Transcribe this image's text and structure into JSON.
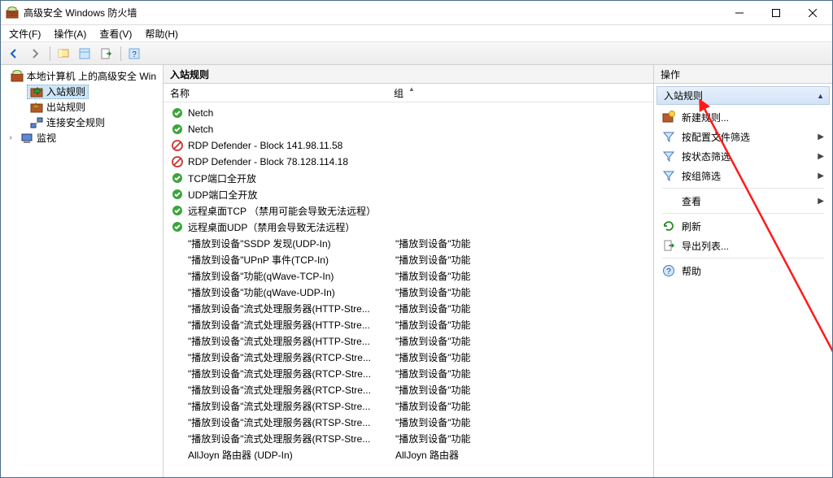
{
  "title": "高级安全 Windows 防火墙",
  "menus": {
    "file": "文件(F)",
    "action": "操作(A)",
    "view": "查看(V)",
    "help": "帮助(H)"
  },
  "tree": {
    "root": "本地计算机 上的高级安全 Win",
    "inbound": "入站规则",
    "outbound": "出站规则",
    "connsec": "连接安全规则",
    "monitor": "监视"
  },
  "columns": {
    "name": "名称",
    "group": "组"
  },
  "right": {
    "header": "操作",
    "section": "入站规则",
    "new_rule": "新建规则...",
    "filter_profile": "按配置文件筛选",
    "filter_state": "按状态筛选",
    "filter_group": "按组筛选",
    "view": "查看",
    "refresh": "刷新",
    "export": "导出列表...",
    "help": "帮助"
  },
  "rules": [
    {
      "icon": "allow",
      "name": "Netch",
      "group": ""
    },
    {
      "icon": "allow",
      "name": "Netch",
      "group": ""
    },
    {
      "icon": "block",
      "name": "RDP Defender - Block 141.98.11.58",
      "group": ""
    },
    {
      "icon": "block",
      "name": "RDP Defender - Block 78.128.114.18",
      "group": ""
    },
    {
      "icon": "allow",
      "name": "TCP端口全开放",
      "group": ""
    },
    {
      "icon": "allow",
      "name": "UDP端口全开放",
      "group": ""
    },
    {
      "icon": "allow",
      "name": "远程桌面TCP （禁用可能会导致无法远程）",
      "group": ""
    },
    {
      "icon": "allow",
      "name": "远程桌面UDP（禁用会导致无法远程）",
      "group": ""
    },
    {
      "icon": "none",
      "name": "\"播放到设备\"SSDP 发现(UDP-In)",
      "group": "\"播放到设备\"功能"
    },
    {
      "icon": "none",
      "name": "\"播放到设备\"UPnP 事件(TCP-In)",
      "group": "\"播放到设备\"功能"
    },
    {
      "icon": "none",
      "name": "\"播放到设备\"功能(qWave-TCP-In)",
      "group": "\"播放到设备\"功能"
    },
    {
      "icon": "none",
      "name": "\"播放到设备\"功能(qWave-UDP-In)",
      "group": "\"播放到设备\"功能"
    },
    {
      "icon": "none",
      "name": "\"播放到设备\"流式处理服务器(HTTP-Stre...",
      "group": "\"播放到设备\"功能"
    },
    {
      "icon": "none",
      "name": "\"播放到设备\"流式处理服务器(HTTP-Stre...",
      "group": "\"播放到设备\"功能"
    },
    {
      "icon": "none",
      "name": "\"播放到设备\"流式处理服务器(HTTP-Stre...",
      "group": "\"播放到设备\"功能"
    },
    {
      "icon": "none",
      "name": "\"播放到设备\"流式处理服务器(RTCP-Stre...",
      "group": "\"播放到设备\"功能"
    },
    {
      "icon": "none",
      "name": "\"播放到设备\"流式处理服务器(RTCP-Stre...",
      "group": "\"播放到设备\"功能"
    },
    {
      "icon": "none",
      "name": "\"播放到设备\"流式处理服务器(RTCP-Stre...",
      "group": "\"播放到设备\"功能"
    },
    {
      "icon": "none",
      "name": "\"播放到设备\"流式处理服务器(RTSP-Stre...",
      "group": "\"播放到设备\"功能"
    },
    {
      "icon": "none",
      "name": "\"播放到设备\"流式处理服务器(RTSP-Stre...",
      "group": "\"播放到设备\"功能"
    },
    {
      "icon": "none",
      "name": "\"播放到设备\"流式处理服务器(RTSP-Stre...",
      "group": "\"播放到设备\"功能"
    },
    {
      "icon": "none",
      "name": "AllJoyn 路由器 (UDP-In)",
      "group": "AllJoyn 路由器"
    }
  ]
}
